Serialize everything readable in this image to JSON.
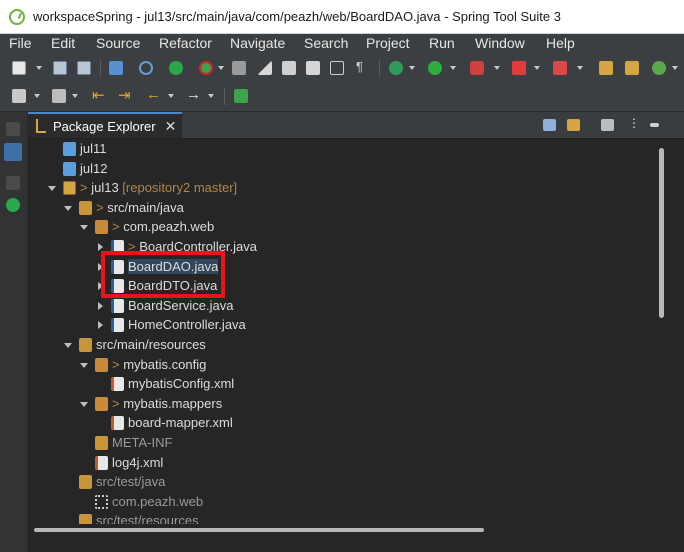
{
  "window": {
    "title": "workspaceSpring - jul13/src/main/java/com/peazh/web/BoardDAO.java - Spring Tool Suite 3"
  },
  "menu": [
    "File",
    "Edit",
    "Source",
    "Refactor",
    "Navigate",
    "Search",
    "Project",
    "Run",
    "Window",
    "Help"
  ],
  "toolbar_icons": [
    "new-icon",
    "save-icon",
    "save-all-icon",
    "terminal-icon",
    "search-icon",
    "power-icon",
    "boot-dashboard-icon",
    "hammer-icon",
    "brush-icon",
    "spring-icon",
    "link-icon",
    "dock-icon",
    "paragraph-icon",
    "debug-icon",
    "run-icon",
    "run-external-icon",
    "stop-icon",
    "coverage-icon",
    "new-project-icon",
    "open-type-icon",
    "new-class-icon"
  ],
  "view": {
    "tab_label": "Package Explorer"
  },
  "tree": [
    {
      "label": "jul11",
      "kind": "folder",
      "depth": 0,
      "state": "none"
    },
    {
      "label": "jul12",
      "kind": "folder",
      "depth": 0,
      "state": "none"
    },
    {
      "label": "jul13",
      "suffix": "[repository2 master]",
      "kind": "project",
      "depth": 0,
      "state": "expanded",
      "dirty": true
    },
    {
      "label": "src/main/java",
      "kind": "source",
      "depth": 1,
      "state": "expanded",
      "dirty": true
    },
    {
      "label": "com.peazh.web",
      "kind": "package",
      "depth": 2,
      "state": "expanded",
      "dirty": true
    },
    {
      "label": "BoardController.java",
      "kind": "java",
      "depth": 3,
      "state": "collapsed",
      "dirty": true
    },
    {
      "label": "BoardDAO.java",
      "kind": "java",
      "depth": 3,
      "state": "collapsed",
      "selected": true
    },
    {
      "label": "BoardDTO.java",
      "kind": "java",
      "depth": 3,
      "state": "collapsed"
    },
    {
      "label": "BoardService.java",
      "kind": "java",
      "depth": 3,
      "state": "collapsed"
    },
    {
      "label": "HomeController.java",
      "kind": "java",
      "depth": 3,
      "state": "collapsed"
    },
    {
      "label": "src/main/resources",
      "kind": "source",
      "depth": 1,
      "state": "expanded"
    },
    {
      "label": "mybatis.config",
      "kind": "package",
      "depth": 2,
      "state": "expanded",
      "dirty": true
    },
    {
      "label": "mybatisConfig.xml",
      "kind": "xml",
      "depth": 3,
      "state": "none"
    },
    {
      "label": "mybatis.mappers",
      "kind": "package",
      "depth": 2,
      "state": "expanded",
      "dirty": true
    },
    {
      "label": "board-mapper.xml",
      "kind": "xml",
      "depth": 3,
      "state": "none"
    },
    {
      "label": "META-INF",
      "kind": "folder-plain",
      "depth": 2,
      "state": "none",
      "dim": true
    },
    {
      "label": "log4j.xml",
      "kind": "xml",
      "depth": 2,
      "state": "none"
    },
    {
      "label": "src/test/java",
      "kind": "source",
      "depth": 1,
      "state": "none",
      "dim": true
    },
    {
      "label": "com.peazh.web",
      "kind": "package-empty",
      "depth": 2,
      "state": "none",
      "dim": true
    },
    {
      "label": "src/test/resources",
      "kind": "source",
      "depth": 1,
      "state": "none",
      "dim": true
    }
  ],
  "colors": {
    "highlight": "#e8141b",
    "accent": "#4a88c7"
  }
}
